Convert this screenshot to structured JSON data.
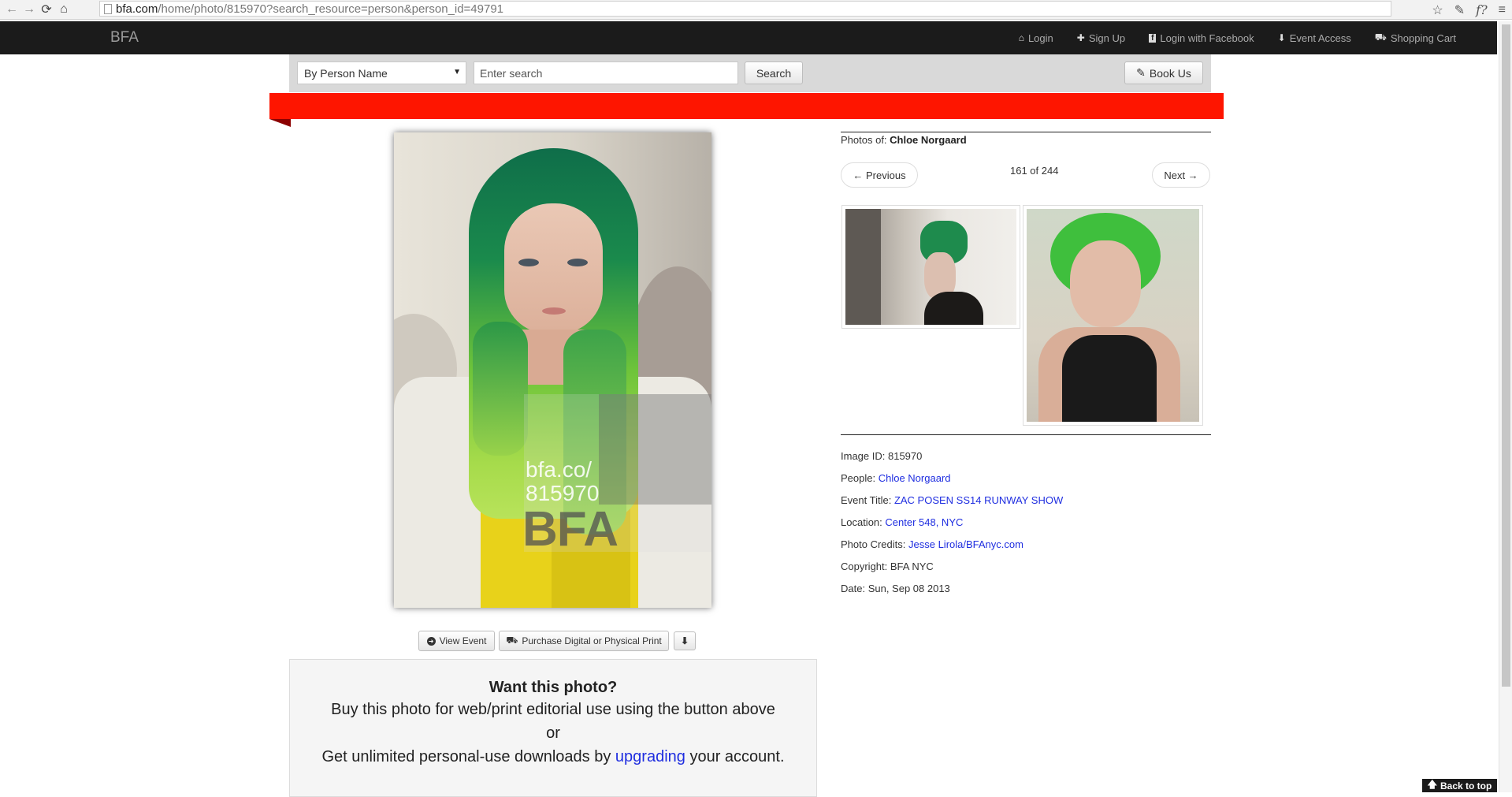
{
  "browser": {
    "url_domain": "bfa.com",
    "url_path": "/home/photo/815970?search_resource=person&person_id=49791"
  },
  "topbar": {
    "brand": "BFA",
    "nav": [
      {
        "label": "Login",
        "icon": "home-icon"
      },
      {
        "label": "Sign Up",
        "icon": "plus-icon"
      },
      {
        "label": "Login with Facebook",
        "icon": "facebook-icon"
      },
      {
        "label": "Event Access",
        "icon": "user-icon"
      },
      {
        "label": "Shopping Cart",
        "icon": "cart-icon"
      }
    ]
  },
  "search": {
    "mode_selected": "By Person Name",
    "placeholder": "Enter search",
    "button_label": "Search",
    "book_us_label": "Book Us"
  },
  "photo": {
    "watermark_text_line1": "bfa.co/",
    "watermark_text_line2": "815970",
    "watermark_logo": "BFA",
    "view_event_label": "View Event",
    "purchase_label": "Purchase Digital or Physical Print"
  },
  "want": {
    "heading": "Want this photo?",
    "line1": "Buy this photo for web/print editorial use using the button above",
    "line2": "or",
    "line3_pre": "Get unlimited personal-use downloads by ",
    "line3_link": "upgrading",
    "line3_post": " your account."
  },
  "sidebar": {
    "photos_of_label": "Photos of:",
    "person_name": "Chloe Norgaard",
    "previous_label": "← Previous",
    "next_label": "Next →",
    "counter": "161 of 244"
  },
  "details": {
    "image_id_label": "Image ID:",
    "image_id": "815970",
    "people_label": "People:",
    "people": "Chloe Norgaard",
    "event_title_label": "Event Title:",
    "event_title": "ZAC POSEN SS14 RUNWAY SHOW",
    "location_label": "Location:",
    "location": "Center 548, NYC",
    "credits_label": "Photo Credits:",
    "credits": "Jesse Lirola/BFAnyc.com",
    "copyright_label": "Copyright:",
    "copyright": "BFA NYC",
    "date_label": "Date:",
    "date": "Sun, Sep 08 2013"
  },
  "back_to_top_label": "Back to top"
}
